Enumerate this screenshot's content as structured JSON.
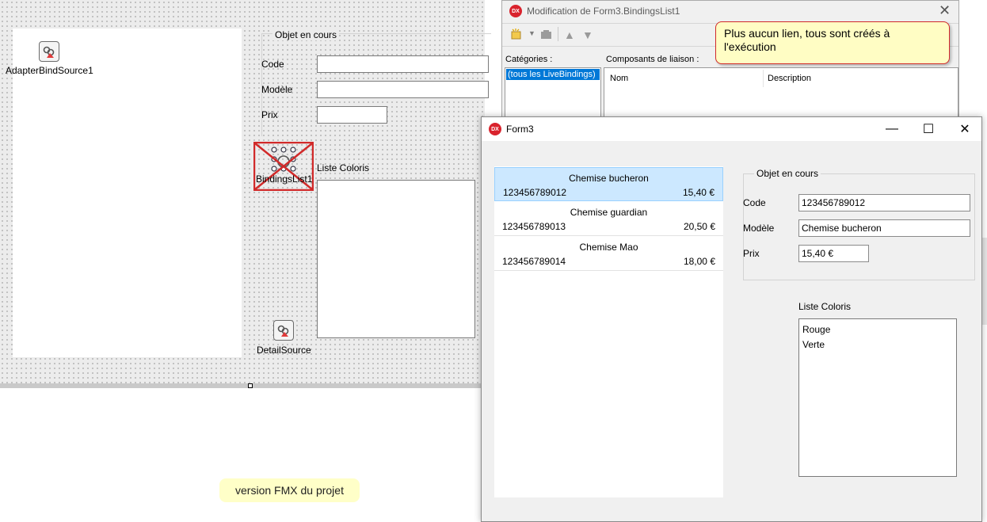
{
  "designer": {
    "components": {
      "adapter": "AdapterBindSource1",
      "bindings_list": "BindingsList1",
      "detail_source": "DetailSource"
    },
    "group_title": "Objet en cours",
    "fields": {
      "code": "Code",
      "model": "Modèle",
      "price": "Prix"
    },
    "colors_label": "Liste Coloris"
  },
  "bindings_editor": {
    "title": "Modification de Form3.BindingsList1",
    "categories_label": "Catégories :",
    "category_selected": "(tous les LiveBindings)",
    "components_label": "Composants de liaison :",
    "columns": [
      "Nom",
      "Description"
    ]
  },
  "callout": {
    "text": "Plus aucun lien, tous sont créés à l'exécution"
  },
  "form3": {
    "title": "Form3",
    "items": [
      {
        "name": "Chemise bucheron",
        "code": "123456789012",
        "price": "15,40 €",
        "selected": true
      },
      {
        "name": "Chemise guardian",
        "code": "123456789013",
        "price": "20,50 €",
        "selected": false
      },
      {
        "name": "Chemise Mao",
        "code": "123456789014",
        "price": "18,00 €",
        "selected": false
      }
    ],
    "group_title": "Objet en cours",
    "fields": {
      "code_label": "Code",
      "code_value": "123456789012",
      "model_label": "Modèle",
      "model_value": "Chemise bucheron",
      "price_label": "Prix",
      "price_value": "15,40 €"
    },
    "colors_label": "Liste Coloris",
    "colors": [
      "Rouge",
      "Verte"
    ]
  },
  "version_note": "version FMX du projet",
  "colors": {
    "selection": "#cce8ff",
    "accent_red": "#d12a2a",
    "callout_bg": "#fffdc4",
    "category_highlight": "#0078d7"
  }
}
